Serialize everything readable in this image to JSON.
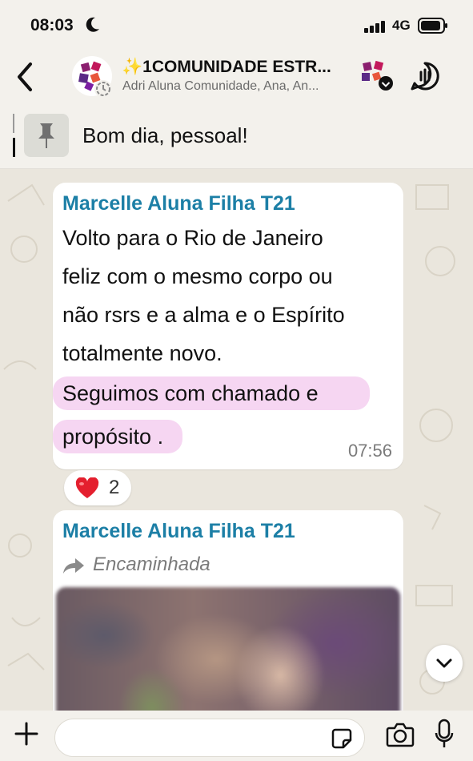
{
  "status_bar": {
    "time": "08:03",
    "network": "4G"
  },
  "header": {
    "title": "✨1COMUNIDADE ESTR...",
    "subtitle": "Adri Aluna Comunidade, Ana, An..."
  },
  "pinned": {
    "text": "Bom dia, pessoal!"
  },
  "messages": [
    {
      "sender": "Marcelle Aluna Filha T21",
      "lines": [
        "Volto para o Rio de Janeiro",
        "feliz com o mesmo corpo ou",
        "não rsrs e a alma e o Espírito",
        "totalmente novo."
      ],
      "highlighted_lines": [
        "Seguimos com chamado e",
        "propósito ."
      ],
      "time": "07:56",
      "reaction": {
        "emoji": "❤️",
        "count": "2"
      }
    },
    {
      "sender": "Marcelle Aluna Filha T21",
      "forwarded_label": "Encaminhada"
    }
  ],
  "colors": {
    "sender": "#1c7fa6",
    "highlight": "#f6d6f2",
    "bubble": "#ffffff",
    "chat_bg": "#eae6dd"
  },
  "icons": [
    "moon-icon",
    "signal-icon",
    "battery-icon",
    "back-icon",
    "group-avatar",
    "call-icon",
    "pin-icon",
    "heart-icon",
    "forward-icon",
    "chevron-down-icon",
    "plus-icon",
    "sticker-icon",
    "camera-icon",
    "mic-icon"
  ]
}
